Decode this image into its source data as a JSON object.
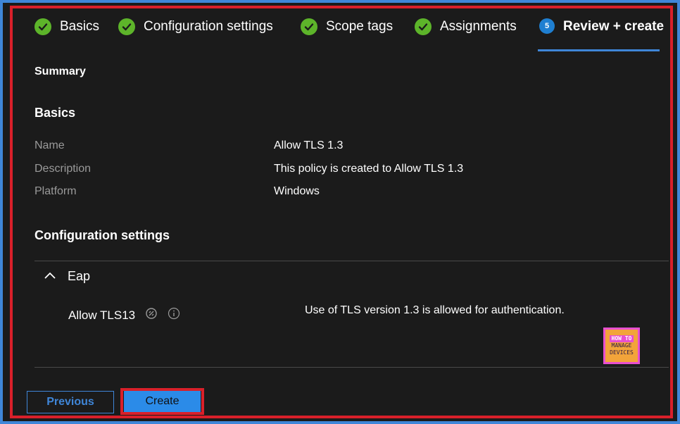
{
  "tabs": [
    {
      "label": "Basics",
      "status": "complete"
    },
    {
      "label": "Configuration settings",
      "status": "complete"
    },
    {
      "label": "Scope tags",
      "status": "complete"
    },
    {
      "label": "Assignments",
      "status": "complete"
    },
    {
      "label": "Review + create",
      "status": "active",
      "number": "5"
    }
  ],
  "summary": {
    "title": "Summary",
    "basics": {
      "heading": "Basics",
      "fields": [
        {
          "key": "Name",
          "value": "Allow TLS 1.3"
        },
        {
          "key": "Description",
          "value": "This policy is created to Allow TLS 1.3"
        },
        {
          "key": "Platform",
          "value": "Windows"
        }
      ]
    },
    "configuration": {
      "heading": "Configuration settings",
      "group": "Eap",
      "setting_name": "Allow TLS13",
      "setting_value": "Use of TLS version 1.3 is allowed for authentication."
    }
  },
  "logo": {
    "line1": "HOW TO",
    "line2": "MANAGE",
    "line3": "DEVICES"
  },
  "buttons": {
    "previous": "Previous",
    "create": "Create"
  },
  "colors": {
    "accent": "#3f86d8",
    "check": "#5db42a",
    "highlight": "#d9202a",
    "create_bg": "#2b8be8"
  }
}
